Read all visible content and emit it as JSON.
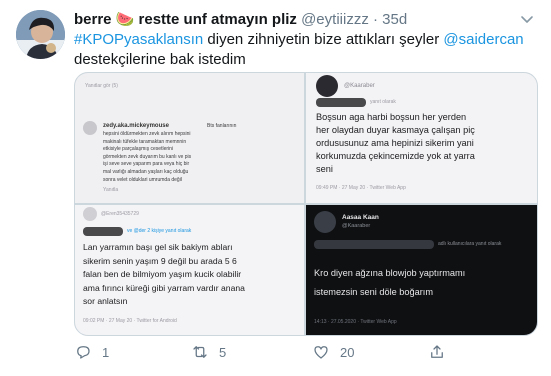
{
  "tweet": {
    "author_name": "berre 🍉 restte unf atmayın pliz",
    "handle": "@eytiiizzz",
    "separator": "·",
    "time": "35d",
    "text": {
      "hashtag": "#KPOPyasaklansın",
      "middle": " diyen zihniyetin bize attıkları şeyler ",
      "mention": "@saidercan",
      "end": " destekçilerine bak istedim"
    }
  },
  "media": {
    "panel1": {
      "username": "zedy.aka.mickeymouse",
      "lines": [
        "Bts fanlarının",
        "hepsini öldürmekten zevk alırım hepsini",
        "makinalı tüfekle taramaktan memnnin",
        "etkisiyle parçalaşmış cesetlerini",
        "görmekten zevk duyarım bu kanlı ve pis",
        "işi seve seve yaparım para veya hiç bir",
        "mal varlığı almadan yaşları kaç olduğu",
        "sonra velet olduklari umrumda değil"
      ],
      "top_meta": "Yanıtlar gör (5)",
      "mid_meta": "Yanıtla"
    },
    "panel2": {
      "username": "@Kaaraber",
      "reply_meta": "yanıt olarak",
      "lines": [
        "Boşsun aga harbi boşsun her yerden",
        "her olaydan duyar kasmaya çalışan piç",
        "ordususunuz ama hepinizi sikerim yani",
        "korkumuzda çekincemizde yok at yarra",
        "seni"
      ],
      "footer": "09:49 PM · 27 May 20 · Twitter Web App"
    },
    "panel3": {
      "username": "@Eren35435729",
      "reply_meta": "ve @der 2 kişiye yanıt olarak",
      "lines": [
        "Lan yarramın başı gel sik bakiym abları",
        "sikerim senin yaşım 9 değil bu arada 5 6",
        "falan ben de bilmiyom yaşım kucik olabilir",
        "ama fırıncı küreği gibi yarram vardır anana",
        "sor anlatsın"
      ],
      "footer": "09:02 PM · 27 May 20 · Twitter for Android"
    },
    "panel4": {
      "name": "Aasaa Kaan",
      "username": "@Kaaraber",
      "reply_meta": "adlı kullanıcılara yanıt olarak",
      "lines": [
        "Kro diyen ağzına blowjob yaptırmamı",
        "istemezsin seni döle boğarım"
      ],
      "footer": "14:13 · 27.05.2020 · Twitter Web App"
    }
  },
  "actions": {
    "reply_count": "1",
    "retweet_count": "5",
    "like_count": "20"
  },
  "colors": {
    "link": "#1b95e0",
    "text": "#14171a",
    "muted": "#657786",
    "watermelon": "#e0245e"
  }
}
